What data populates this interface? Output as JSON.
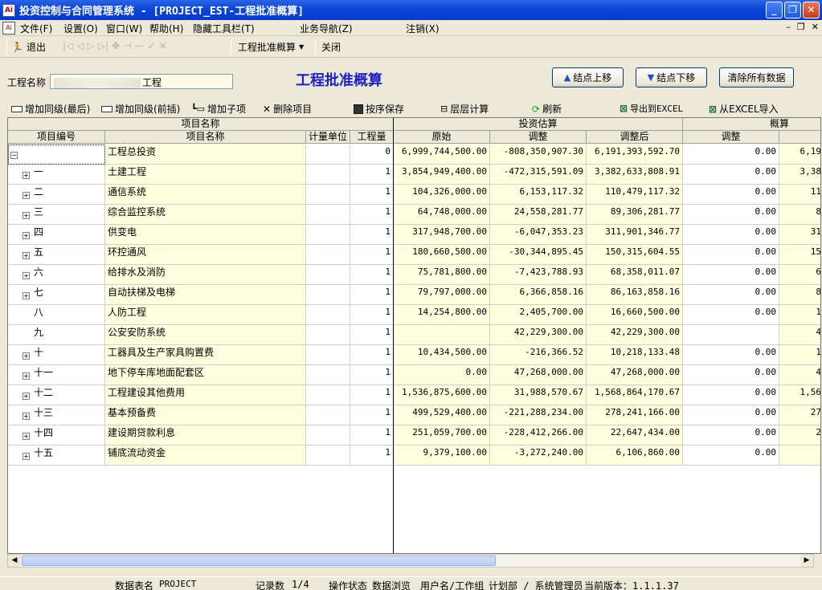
{
  "window": {
    "title": "投资控制与合同管理系统 - [PROJECT_EST-工程批准概算]",
    "icon_text": "Ai",
    "buttons": [
      "minimize",
      "restore",
      "close"
    ]
  },
  "menu": {
    "items": [
      "文件(F)",
      "设置(O)",
      "窗口(W)",
      "帮助(H)",
      "隐藏工具栏(T)",
      "业务导航(Z)",
      "注销(X)"
    ]
  },
  "toolbar": {
    "exit_label": "退出",
    "combo_label": "工程批准概算",
    "close_label": "关闭"
  },
  "form": {
    "project_label": "工程名称",
    "project_value": "工程",
    "page_title": "工程批准概算",
    "btn_up": "结点上移",
    "btn_down": "结点下移",
    "btn_clear": "清除所有数据"
  },
  "actions": {
    "add_sibling_last": "增加同级(最后)",
    "add_sibling_before": "增加同级(前插)",
    "add_child": "增加子项",
    "delete": "删除项目",
    "save_order": "按序保存",
    "layer_calc": "层层计算",
    "refresh": "刷新",
    "export_excel": "导出到EXCEL",
    "import_excel": "从EXCEL导入"
  },
  "grid": {
    "group_headers": {
      "item": "项目名称",
      "invest": "投资估算",
      "budget": "概算"
    },
    "columns": [
      "项目编号",
      "项目名称",
      "计量单位",
      "工程量",
      "原始",
      "调整",
      "调整后",
      "调整"
    ],
    "rows": [
      {
        "code": "",
        "name": "工程总投资",
        "unit": "",
        "qty": "0",
        "orig": "6,999,744,500.00",
        "adj": "-808,350,907.30",
        "after": "6,191,393,592.70",
        "badj": "0.00",
        "tail": "6,19",
        "exp": "minus"
      },
      {
        "code": "一",
        "name": "土建工程",
        "unit": "",
        "qty": "1",
        "orig": "3,854,949,400.00",
        "adj": "-472,315,591.09",
        "after": "3,382,633,808.91",
        "badj": "0.00",
        "tail": "3,38",
        "exp": "plus"
      },
      {
        "code": "二",
        "name": "通信系统",
        "unit": "",
        "qty": "1",
        "orig": "104,326,000.00",
        "adj": "6,153,117.32",
        "after": "110,479,117.32",
        "badj": "0.00",
        "tail": "11",
        "exp": "plus"
      },
      {
        "code": "三",
        "name": "综合监控系统",
        "unit": "",
        "qty": "1",
        "orig": "64,748,000.00",
        "adj": "24,558,281.77",
        "after": "89,306,281.77",
        "badj": "0.00",
        "tail": "8",
        "exp": "plus"
      },
      {
        "code": "四",
        "name": "供变电",
        "unit": "",
        "qty": "1",
        "orig": "317,948,700.00",
        "adj": "-6,047,353.23",
        "after": "311,901,346.77",
        "badj": "0.00",
        "tail": "31",
        "exp": "plus"
      },
      {
        "code": "五",
        "name": "环控通风",
        "unit": "",
        "qty": "1",
        "orig": "180,660,500.00",
        "adj": "-30,344,895.45",
        "after": "150,315,604.55",
        "badj": "0.00",
        "tail": "15",
        "exp": "plus"
      },
      {
        "code": "六",
        "name": "给排水及消防",
        "unit": "",
        "qty": "1",
        "orig": "75,781,800.00",
        "adj": "-7,423,788.93",
        "after": "68,358,011.07",
        "badj": "0.00",
        "tail": "6",
        "exp": "plus"
      },
      {
        "code": "七",
        "name": "自动扶梯及电梯",
        "unit": "",
        "qty": "1",
        "orig": "79,797,000.00",
        "adj": "6,366,858.16",
        "after": "86,163,858.16",
        "badj": "0.00",
        "tail": "8",
        "exp": "plus"
      },
      {
        "code": "八",
        "name": "人防工程",
        "unit": "",
        "qty": "1",
        "orig": "14,254,800.00",
        "adj": "2,405,700.00",
        "after": "16,660,500.00",
        "badj": "0.00",
        "tail": "1",
        "exp": "none"
      },
      {
        "code": "九",
        "name": "公安安防系统",
        "unit": "",
        "qty": "1",
        "orig": "",
        "adj": "42,229,300.00",
        "after": "42,229,300.00",
        "badj": "",
        "tail": "4",
        "exp": "none"
      },
      {
        "code": "十",
        "name": "工器具及生产家具购置费",
        "unit": "",
        "qty": "1",
        "orig": "10,434,500.00",
        "adj": "-216,366.52",
        "after": "10,218,133.48",
        "badj": "0.00",
        "tail": "1",
        "exp": "plus"
      },
      {
        "code": "十一",
        "name": "地下停车库地面配套区",
        "unit": "",
        "qty": "1",
        "orig": "0.00",
        "adj": "47,268,000.00",
        "after": "47,268,000.00",
        "badj": "0.00",
        "tail": "4",
        "exp": "plus"
      },
      {
        "code": "十二",
        "name": "工程建设其他费用",
        "unit": "",
        "qty": "1",
        "orig": "1,536,875,600.00",
        "adj": "31,988,570.67",
        "after": "1,568,864,170.67",
        "badj": "0.00",
        "tail": "1,56",
        "exp": "plus"
      },
      {
        "code": "十三",
        "name": "基本预备费",
        "unit": "",
        "qty": "1",
        "orig": "499,529,400.00",
        "adj": "-221,288,234.00",
        "after": "278,241,166.00",
        "badj": "0.00",
        "tail": "27",
        "exp": "plus"
      },
      {
        "code": "十四",
        "name": "建设期贷款利息",
        "unit": "",
        "qty": "1",
        "orig": "251,059,700.00",
        "adj": "-228,412,266.00",
        "after": "22,647,434.00",
        "badj": "0.00",
        "tail": "2",
        "exp": "plus"
      },
      {
        "code": "十五",
        "name": "铺底流动资金",
        "unit": "",
        "qty": "1",
        "orig": "9,379,100.00",
        "adj": "-3,272,240.00",
        "after": "6,106,860.00",
        "badj": "0.00",
        "tail": "",
        "exp": "plus"
      }
    ]
  },
  "status": {
    "table_label": "数据表名",
    "table_value": "PROJECT",
    "records_label": "记录数",
    "records_value": "1/4",
    "op_label": "操作状态",
    "op_value": "数据浏览",
    "user_label": "用户名/工作组",
    "user_value": "计划部 / 系统管理员",
    "version": "当前版本：1.1.1.37"
  }
}
